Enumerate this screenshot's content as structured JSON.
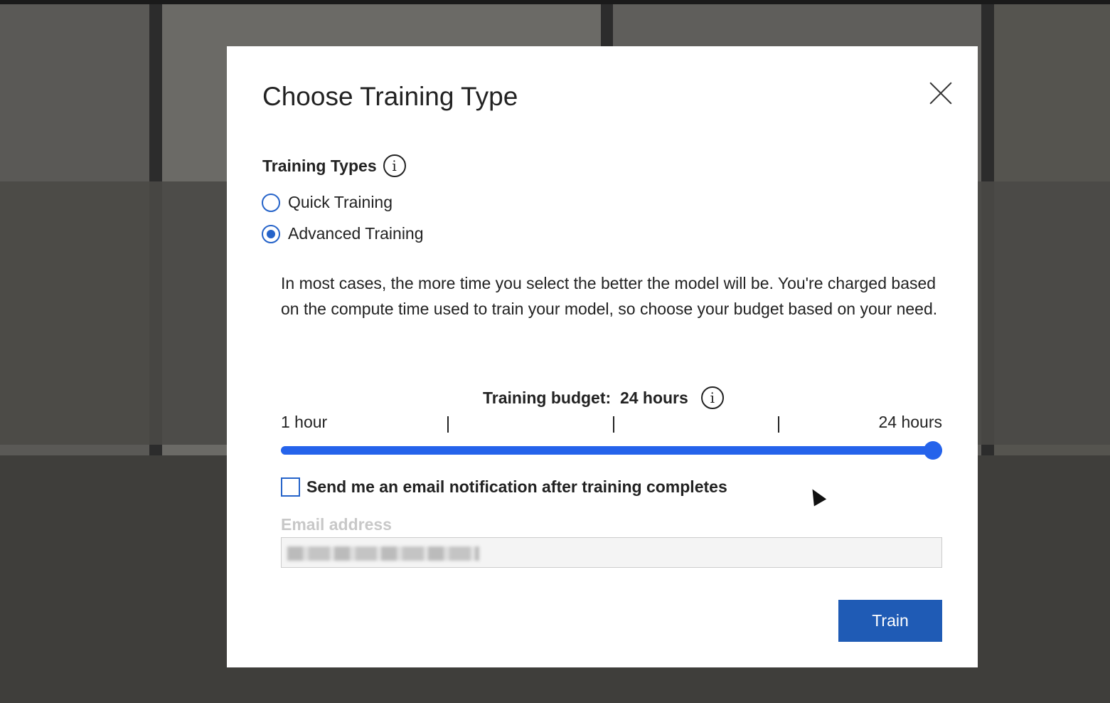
{
  "dialog": {
    "title": "Choose Training Type",
    "section_label": "Training Types",
    "options": [
      {
        "label": "Quick Training",
        "selected": false
      },
      {
        "label": "Advanced Training",
        "selected": true
      }
    ],
    "description": "In most cases, the more time you select the better the model will be. You're charged based on the compute time used to train your model, so choose your budget based on your need.",
    "budget": {
      "label": "Training budget:",
      "value_text": "24 hours",
      "min_label": "1 hour",
      "max_label": "24 hours",
      "min": 1,
      "max": 24,
      "value": 24
    },
    "email_checkbox": {
      "label": "Send me an email notification after training completes",
      "checked": false
    },
    "email_label": "Email address",
    "train_label": "Train",
    "info_icon": "i"
  },
  "colors": {
    "accent": "#2563eb",
    "button": "#1f5bb5"
  }
}
